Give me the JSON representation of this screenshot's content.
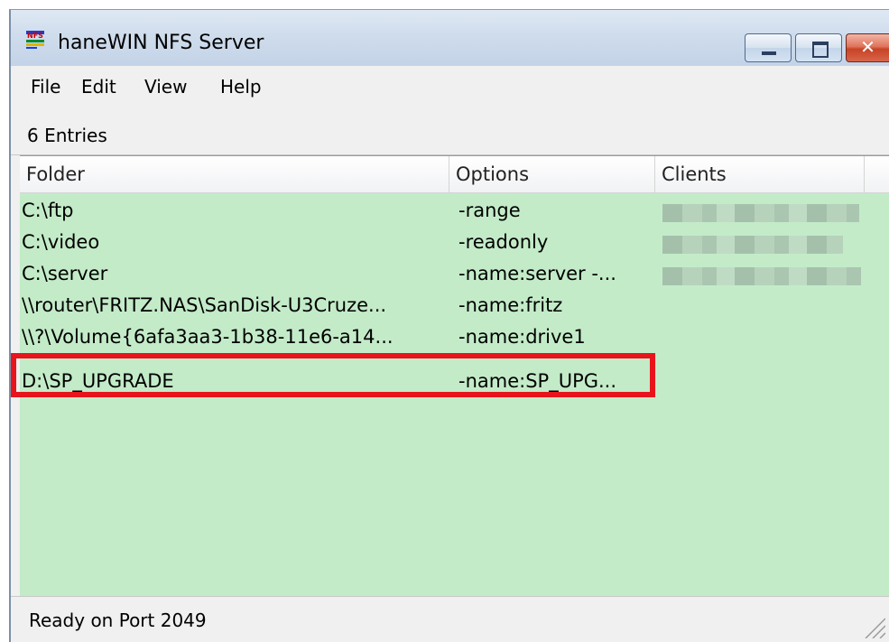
{
  "window": {
    "title": "haneWIN NFS Server",
    "icon": "nfs-app-icon"
  },
  "title_buttons": {
    "minimize": "minimize-icon",
    "maximize": "maximize-icon",
    "close": "close-icon",
    "close_glyph": "✕"
  },
  "menu": [
    {
      "label": "File"
    },
    {
      "label": "Edit"
    },
    {
      "label": "View"
    },
    {
      "label": "Help"
    }
  ],
  "entries_text": "6 Entries",
  "columns": {
    "folder": "Folder",
    "options": "Options",
    "clients": "Clients"
  },
  "rows": [
    {
      "folder": "C:\\ftp",
      "options": "-range",
      "clients_blurred": true
    },
    {
      "folder": "C:\\video",
      "options": "-readonly",
      "clients_blurred": true
    },
    {
      "folder": "C:\\server",
      "options": "-name:server -...",
      "clients_blurred": true
    },
    {
      "folder": "\\\\router\\FRITZ.NAS\\SanDisk-U3Cruze...",
      "options": "-name:fritz",
      "clients_blurred": false
    },
    {
      "folder": "\\\\?\\Volume{6afa3aa3-1b38-11e6-a14...",
      "options": "-name:drive1",
      "clients_blurred": false
    },
    {
      "folder": "D:\\SP_UPGRADE",
      "options": "-name:SP_UPG...",
      "clients_blurred": false,
      "highlighted": true
    }
  ],
  "colors": {
    "list_background": "#c3ebc8",
    "highlight_border": "#e8141c"
  },
  "status": "Ready on Port 2049"
}
